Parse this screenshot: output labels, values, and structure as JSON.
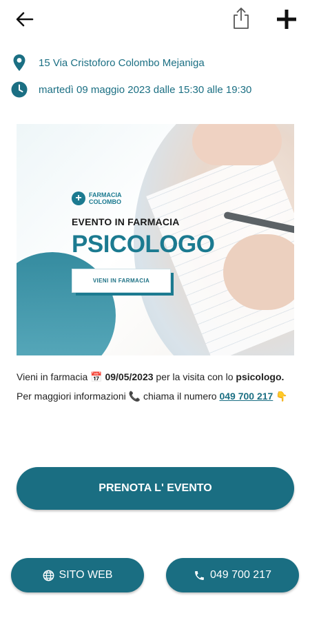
{
  "header": {
    "back_icon": "arrow-left-icon",
    "share_icon": "share-icon",
    "add_icon": "plus-icon"
  },
  "event": {
    "address": "15 Via Cristoforo Colombo Mejaniga",
    "datetime": "martedì 09 maggio 2023  dalle 15:30 alle 19:30",
    "location_icon": "location-pin-icon",
    "clock_icon": "clock-icon"
  },
  "banner": {
    "logo_line1": "FARMACIA",
    "logo_line2": "COLOMBO",
    "event_title": "EVENTO IN FARMACIA",
    "headline": "PSICOLOGO",
    "cta": "VIENI IN FARMACIA"
  },
  "description": {
    "t1": "Vieni in farmacia ",
    "calendar_emoji": "📅",
    "date": " 09/05/2023",
    "t2": " per la visita con lo ",
    "bold_word": "psicologo.",
    "t3": " Per maggiori informazioni ",
    "phone_emoji": "📞",
    "t4": " chiama il numero ",
    "phone": "049 700 217",
    "hand_emoji": "👇"
  },
  "actions": {
    "book_label": "PRENOTA L' EVENTO",
    "web_label": "SITO WEB",
    "call_label": "049 700 217"
  },
  "colors": {
    "accent": "#1a6e82",
    "text_accent": "#1b6f83"
  }
}
